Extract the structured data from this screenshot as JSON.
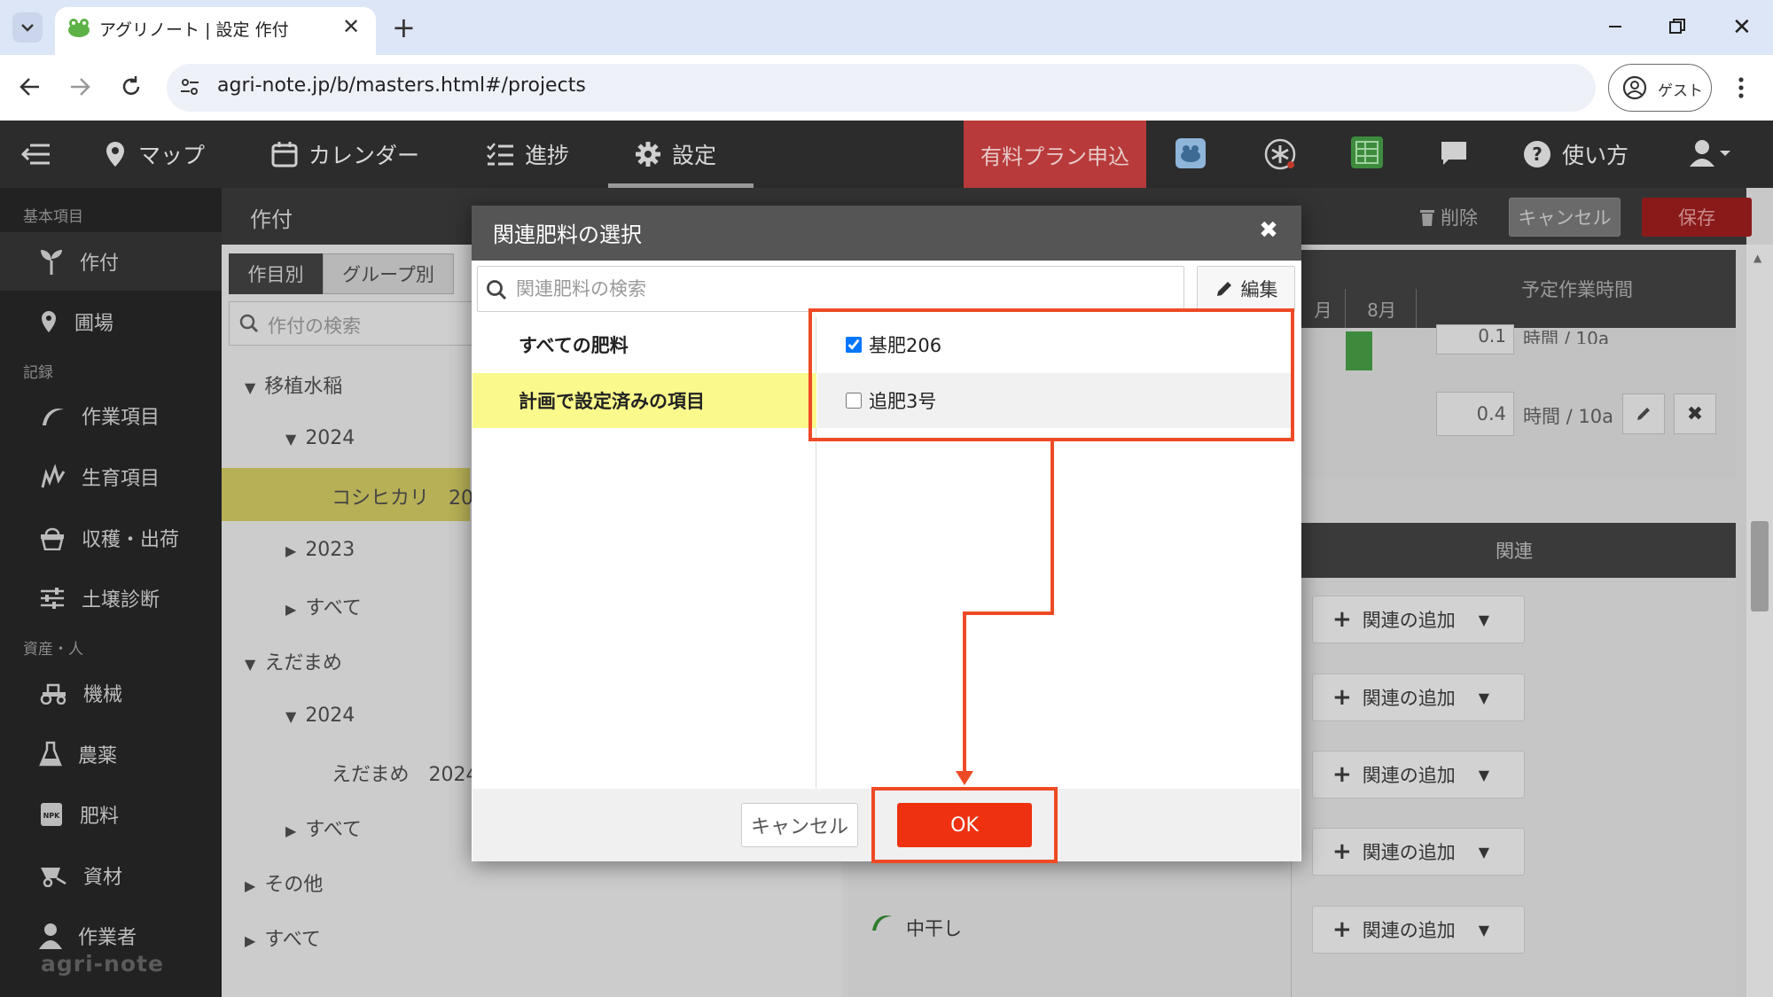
{
  "browser": {
    "tab_title": "アグリノート | 設定 作付",
    "url": "agri-note.jp/b/masters.html#/projects",
    "guest_label": "ゲスト"
  },
  "nav": {
    "map": "マップ",
    "calendar": "カレンダー",
    "progress": "進捗",
    "settings": "設定",
    "paid_plan": "有料プラン申込",
    "help": "使い方"
  },
  "sidebar": {
    "section_basic": "基本項目",
    "section_record": "記録",
    "section_assets": "資産・人",
    "items": {
      "crop": "作付",
      "field": "圃場",
      "work": "作業項目",
      "growth": "生育項目",
      "harvest": "収穫・出荷",
      "soil": "土壌診断",
      "machine": "機械",
      "pesticide": "農薬",
      "fertilizer": "肥料",
      "material": "資材",
      "worker": "作業者"
    },
    "brand": "agri-note"
  },
  "main": {
    "title": "作付",
    "delete": "削除",
    "cancel": "キャンセル",
    "save": "保存",
    "tab_by_crop": "作目別",
    "tab_by_group": "グループ別",
    "search_placeholder": "作付の検索",
    "tree": {
      "r1": "移植水稲",
      "r2": "2024",
      "r3": "コシヒカリ　20",
      "r4": "2023",
      "r5": "すべて",
      "r6": "えだまめ",
      "r7": "2024",
      "r8": "えだまめ　2024",
      "r9": "すべて",
      "r10": "その他",
      "r11": "すべて"
    },
    "month_partial": "月",
    "month_aug": "8月",
    "planned_time_header": "予定作業時間",
    "time_value_1": "0.1",
    "time_value_2": "0.4",
    "time_unit": "時間 / 10a",
    "relation_header": "関連",
    "add_relation": "関連の追加",
    "work_item": "中干し"
  },
  "modal": {
    "title": "関連肥料の選択",
    "search_placeholder": "関連肥料の検索",
    "edit_button": "編集",
    "categories": [
      "すべての肥料",
      "計画で設定済みの項目"
    ],
    "items": [
      {
        "label": "基肥206",
        "checked": true
      },
      {
        "label": "追肥3号",
        "checked": false
      }
    ],
    "cancel_button": "キャンセル",
    "ok_button": "OK"
  },
  "colors": {
    "annotation": "#ee4a25",
    "ok_button": "#ee3211",
    "paid_plan": "#b83a3a",
    "selected_category": "#fafa8c"
  }
}
